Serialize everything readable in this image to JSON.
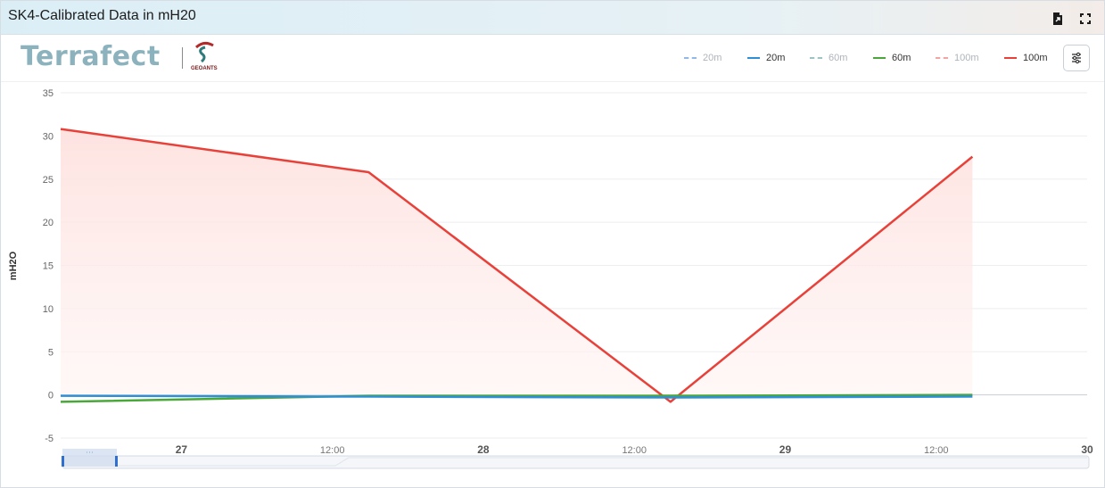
{
  "header": {
    "title": "SK4-Calibrated Data in mH20"
  },
  "logo": {
    "brand": "Terrafect",
    "partner": "GEOANTS"
  },
  "legend": [
    {
      "label": "20m",
      "color": "#8fb9e8",
      "style": "dashed",
      "active": false
    },
    {
      "label": "20m",
      "color": "#2f8fd5",
      "style": "solid",
      "active": true
    },
    {
      "label": "60m",
      "color": "#9cc4c4",
      "style": "dashed",
      "active": false
    },
    {
      "label": "60m",
      "color": "#4aa83a",
      "style": "solid",
      "active": true
    },
    {
      "label": "100m",
      "color": "#f5a3a3",
      "style": "dashed",
      "active": false
    },
    {
      "label": "100m",
      "color": "#e8413a",
      "style": "solid",
      "active": true
    }
  ],
  "colors": {
    "series_20m": "#2f8fd5",
    "series_60m": "#4aa83a",
    "series_100m": "#e8413a",
    "area_fill": "#fde3e1"
  },
  "chart_data": {
    "type": "line",
    "ylabel": "mH2O",
    "ylim": [
      -5,
      35
    ],
    "yticks": [
      -5,
      0,
      5,
      10,
      15,
      20,
      25,
      30,
      35
    ],
    "xlim": [
      26.6,
      30.0
    ],
    "xticks": [
      {
        "value": 27,
        "label": "27",
        "major": true
      },
      {
        "value": 27.5,
        "label": "12:00",
        "major": false
      },
      {
        "value": 28,
        "label": "28",
        "major": true
      },
      {
        "value": 28.5,
        "label": "12:00",
        "major": false
      },
      {
        "value": 29,
        "label": "29",
        "major": true
      },
      {
        "value": 29.5,
        "label": "12:00",
        "major": false
      },
      {
        "value": 30,
        "label": "30",
        "major": true
      }
    ],
    "grid": true,
    "legend_position": "top-right",
    "series": [
      {
        "name": "20m",
        "x": [
          26.6,
          27.62,
          28.62,
          29.62
        ],
        "y": [
          -0.1,
          -0.2,
          -0.3,
          -0.2
        ]
      },
      {
        "name": "60m",
        "x": [
          26.6,
          27.62,
          28.62,
          29.62
        ],
        "y": [
          -0.8,
          -0.1,
          -0.1,
          0.0
        ]
      },
      {
        "name": "100m",
        "x": [
          26.6,
          27.62,
          28.62,
          29.62
        ],
        "y": [
          30.8,
          25.8,
          -0.8,
          27.6
        ]
      }
    ]
  }
}
